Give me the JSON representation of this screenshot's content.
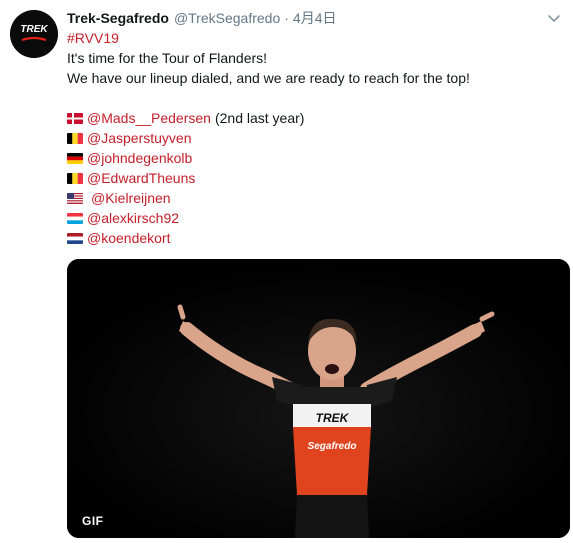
{
  "tweet": {
    "name": "Trek-Segafredo",
    "handle": "@TrekSegafredo",
    "separator": "·",
    "time": "4月4日",
    "hashtag": "#RVV19",
    "line1": "It's time for the Tour of Flanders!",
    "line2": "We have our lineup dialed, and we are ready to reach for the top!",
    "riders": [
      {
        "flag": "denmark-flag-icon",
        "mention": "@Mads__Pedersen",
        "note": "(2nd last year)"
      },
      {
        "flag": "belgium-flag-icon",
        "mention": "@Jasperstuyven",
        "note": ""
      },
      {
        "flag": "germany-flag-icon",
        "mention": "@johndegenkolb",
        "note": ""
      },
      {
        "flag": "belgium-flag-icon",
        "mention": "@EdwardTheuns",
        "note": ""
      },
      {
        "flag": "usa-flag-icon",
        "mention": "@Kielreijnen",
        "note": ""
      },
      {
        "flag": "luxembourg-flag-icon",
        "mention": "@alexkirsch92",
        "note": ""
      },
      {
        "flag": "netherlands-flag-icon",
        "mention": "@koendekort",
        "note": ""
      }
    ],
    "media_badge": "GIF",
    "avatar_logo": "TREK",
    "jersey_brand": "TREK",
    "jersey_sponsor": "Segafredo"
  },
  "colors": {
    "mention": "#c5202a",
    "text": "#14171a",
    "muted": "#657786"
  }
}
